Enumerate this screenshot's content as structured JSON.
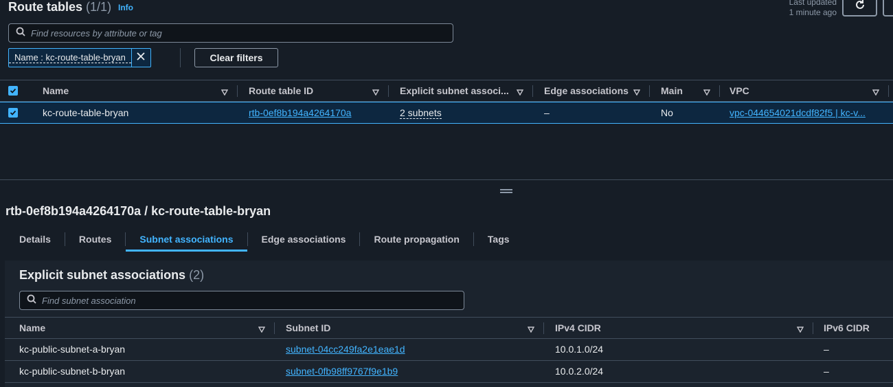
{
  "header": {
    "title": "Route tables",
    "count": "(1/1)",
    "info": "Info",
    "last_updated_label": "Last updated",
    "last_updated_value": "1 minute ago"
  },
  "search": {
    "placeholder": "Find resources by attribute or tag"
  },
  "filter_token": {
    "label": "Name : kc-route-table-bryan"
  },
  "clear_filters": "Clear filters",
  "table": {
    "columns": [
      "Name",
      "Route table ID",
      "Explicit subnet associ...",
      "Edge associations",
      "Main",
      "VPC"
    ],
    "rows": [
      {
        "name": "kc-route-table-bryan",
        "route_table_id": "rtb-0ef8b194a4264170a",
        "explicit_subnet": "2 subnets",
        "edge": "–",
        "main": "No",
        "vpc": "vpc-044654021dcdf82f5 | kc-v..."
      }
    ]
  },
  "detail": {
    "title": "rtb-0ef8b194a4264170a / kc-route-table-bryan",
    "tabs": [
      "Details",
      "Routes",
      "Subnet associations",
      "Edge associations",
      "Route propagation",
      "Tags"
    ],
    "active_tab": "Subnet associations"
  },
  "subnet_panel": {
    "title": "Explicit subnet associations",
    "count": "(2)",
    "search_placeholder": "Find subnet association",
    "columns": [
      "Name",
      "Subnet ID",
      "IPv4 CIDR",
      "IPv6 CIDR"
    ],
    "rows": [
      {
        "name": "kc-public-subnet-a-bryan",
        "subnet_id": "subnet-04cc249fa2e1eae1d",
        "ipv4": "10.0.1.0/24",
        "ipv6": "–"
      },
      {
        "name": "kc-public-subnet-b-bryan",
        "subnet_id": "subnet-0fb98ff9767f9e1b9",
        "ipv4": "10.0.2.0/24",
        "ipv6": "–"
      }
    ]
  },
  "colors": {
    "accent": "#42b4ff",
    "background": "#161d26",
    "panel": "#1b232d",
    "selected_row": "#0d2740"
  }
}
